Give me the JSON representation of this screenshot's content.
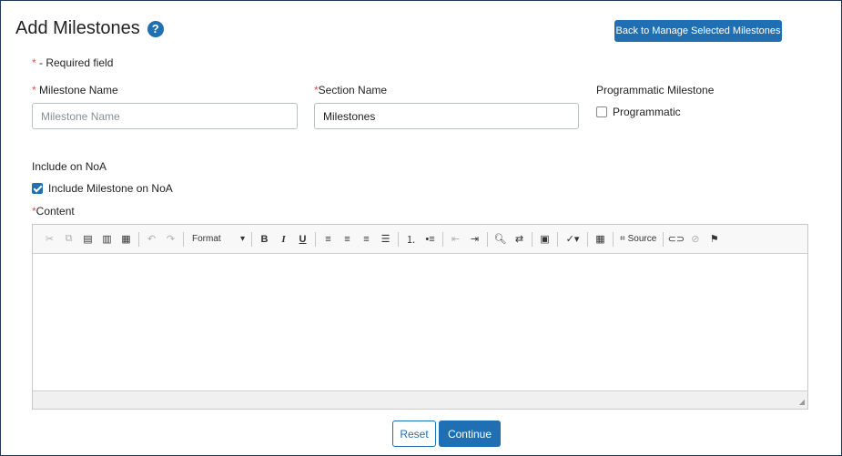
{
  "header": {
    "title": "Add Milestones",
    "help_icon": "?",
    "back_button": "Back to Manage Selected Milestones"
  },
  "form": {
    "required_star": "*",
    "required_note": " - Required field",
    "milestone_name": {
      "label": "Milestone Name",
      "placeholder": "Milestone Name",
      "value": ""
    },
    "section_name": {
      "label": "Section Name",
      "value": "Milestones"
    },
    "programmatic": {
      "label": "Programmatic Milestone",
      "checkbox_label": "Programmatic",
      "checked": false
    },
    "include_noa": {
      "label": "Include on NoA",
      "checkbox_label": "Include Milestone on NoA",
      "checked": true
    },
    "content_label": "Content"
  },
  "editor": {
    "format_label": "Format",
    "source_label": "Source",
    "toolbar_icons": [
      "cut-icon",
      "copy-icon",
      "paste-icon",
      "paste-text-icon",
      "paste-word-icon",
      "undo-icon",
      "redo-icon",
      "bold-icon",
      "italic-icon",
      "underline-icon",
      "align-left-icon",
      "align-center-icon",
      "align-right-icon",
      "justify-icon",
      "numbered-list-icon",
      "bulleted-list-icon",
      "outdent-icon",
      "indent-icon",
      "find-icon",
      "replace-icon",
      "template-icon",
      "spellcheck-icon",
      "table-icon",
      "source-icon",
      "link-icon",
      "unlink-icon",
      "anchor-icon"
    ]
  },
  "actions": {
    "reset": "Reset",
    "continue": "Continue"
  },
  "colors": {
    "primary": "#1f6fb2",
    "required": "#d9534f"
  }
}
